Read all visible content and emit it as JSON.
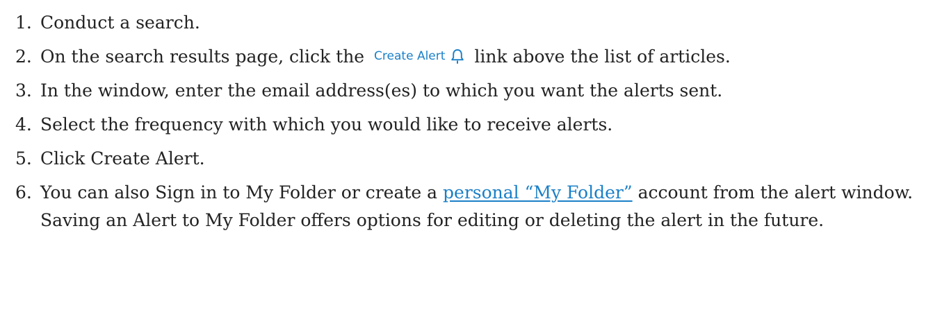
{
  "steps": [
    {
      "num": "1.",
      "text": "Conduct a search."
    },
    {
      "num": "2.",
      "before": "On the search results page, click the",
      "chip_label": "Create Alert",
      "chip_icon": "bell-icon",
      "after": "link above the list of articles."
    },
    {
      "num": "3.",
      "text": "In the window, enter the email address(es) to which you want the alerts sent."
    },
    {
      "num": "4.",
      "text": "Select the frequency with which you would like to receive alerts."
    },
    {
      "num": "5.",
      "text": "Click Create Alert."
    },
    {
      "num": "6.",
      "before": "You can also Sign in to My Folder or create a",
      "link_text": "personal “My Folder”",
      "after": "account from the alert window. Saving an Alert to My Folder offers options for editing or deleting the alert in the future."
    }
  ],
  "colors": {
    "text": "#222222",
    "link": "#1a7fc7",
    "chip": "#1a80c8"
  }
}
